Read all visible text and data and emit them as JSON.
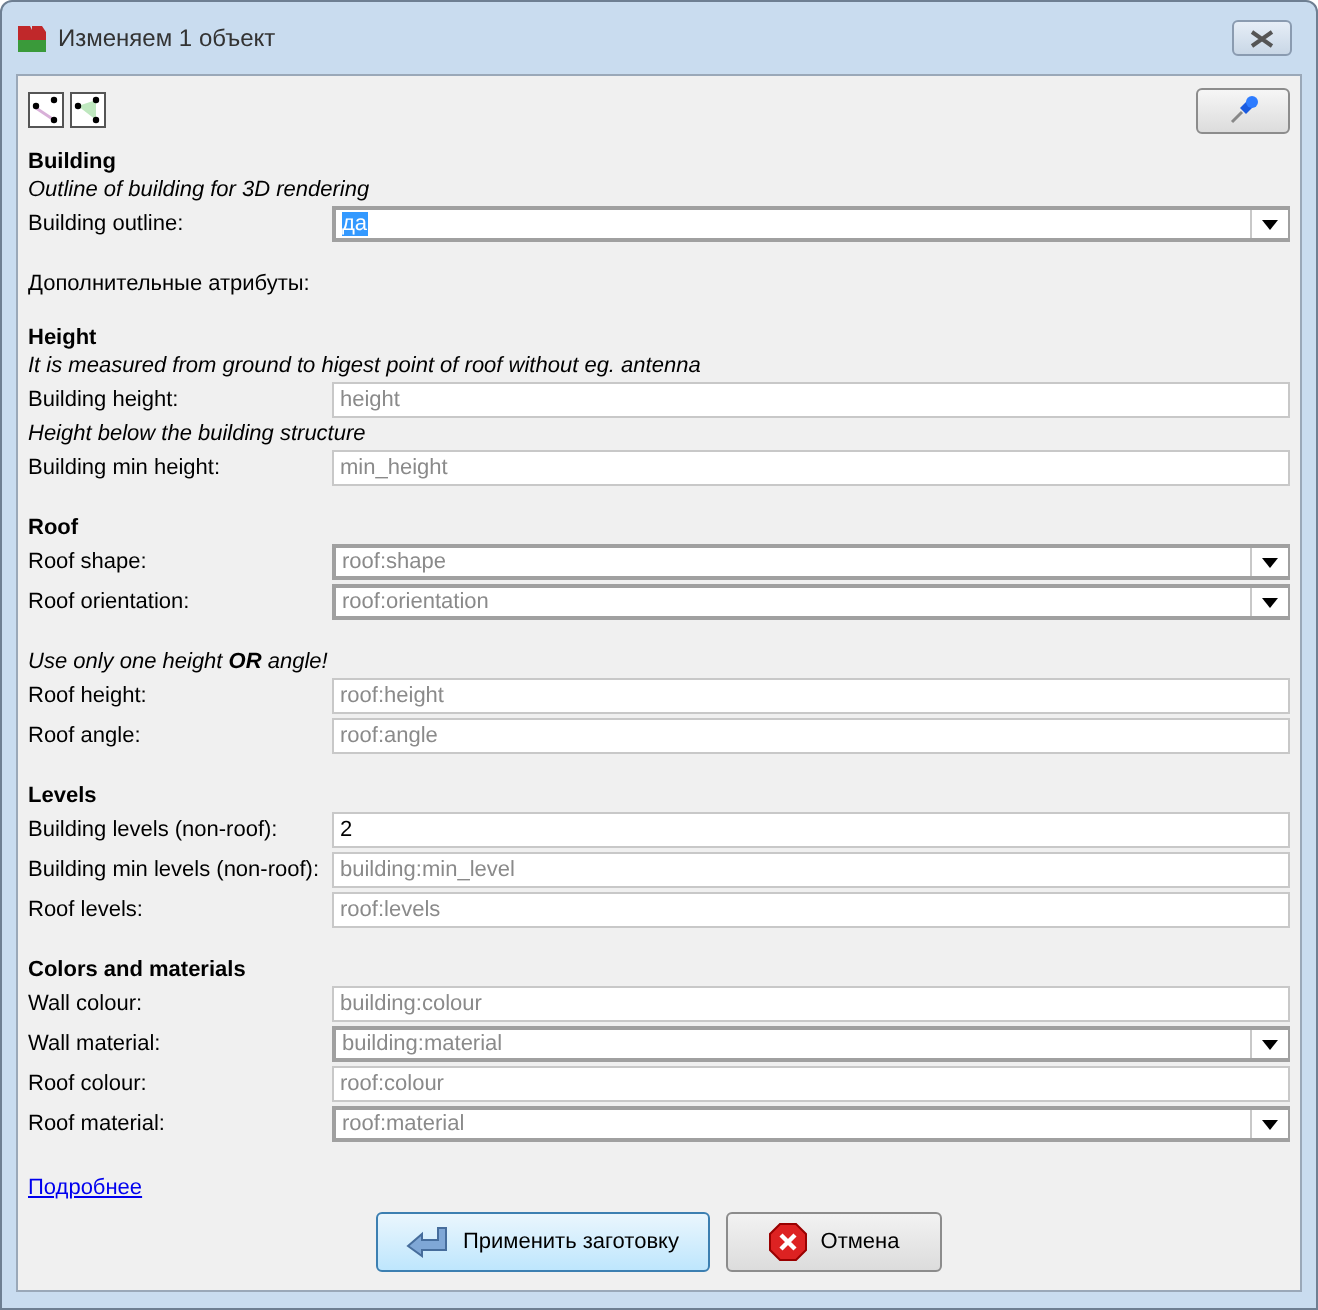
{
  "window": {
    "title": "Изменяем 1 объект"
  },
  "sections": [
    {
      "title": "Building",
      "items": [
        {
          "kind": "hint",
          "text": "Outline of building for 3D rendering"
        },
        {
          "kind": "field",
          "label": "Building outline:",
          "value": "да",
          "dropdown": true,
          "highlighted": true
        }
      ]
    },
    {
      "items": [
        {
          "kind": "note",
          "text": "Дополнительные атрибуты:"
        }
      ]
    },
    {
      "title": "Height",
      "items": [
        {
          "kind": "hint",
          "text": "It is measured from ground to higest point of roof without eg. antenna"
        },
        {
          "kind": "field",
          "label": "Building height:",
          "placeholder": "height",
          "dropdown": false
        },
        {
          "kind": "hint",
          "text": "Height below the building structure"
        },
        {
          "kind": "field",
          "label": "Building min height:",
          "placeholder": "min_height",
          "dropdown": false
        }
      ]
    },
    {
      "title": "Roof",
      "items": [
        {
          "kind": "field",
          "label": "Roof shape:",
          "placeholder": "roof:shape",
          "dropdown": true
        },
        {
          "kind": "field",
          "label": "Roof orientation:",
          "placeholder": "roof:orientation",
          "dropdown": true
        }
      ]
    },
    {
      "items": [
        {
          "kind": "hint",
          "text": "Use only one height **OR** angle!"
        },
        {
          "kind": "field",
          "label": "Roof height:",
          "placeholder": "roof:height",
          "dropdown": false
        },
        {
          "kind": "field",
          "label": "Roof angle:",
          "placeholder": "roof:angle",
          "dropdown": false
        }
      ]
    },
    {
      "title": "Levels",
      "items": [
        {
          "kind": "field",
          "label": "Building levels (non-roof):",
          "value": "2",
          "dropdown": false
        },
        {
          "kind": "field",
          "label": "Building min levels (non-roof):",
          "placeholder": "building:min_level",
          "dropdown": false
        },
        {
          "kind": "field",
          "label": "Roof levels:",
          "placeholder": "roof:levels",
          "dropdown": false
        }
      ]
    },
    {
      "title": "Colors and materials",
      "items": [
        {
          "kind": "field",
          "label": "Wall colour:",
          "placeholder": "building:colour",
          "dropdown": false
        },
        {
          "kind": "field",
          "label": "Wall material:",
          "placeholder": "building:material",
          "dropdown": true
        },
        {
          "kind": "field",
          "label": "Roof colour:",
          "placeholder": "roof:colour",
          "dropdown": false
        },
        {
          "kind": "field",
          "label": "Roof material:",
          "placeholder": "roof:material",
          "dropdown": true
        }
      ]
    }
  ],
  "link": "Подробнее",
  "buttons": [
    {
      "kind": "apply",
      "label": "Применить заготовку"
    },
    {
      "kind": "cancel",
      "label": "Отмена"
    }
  ]
}
